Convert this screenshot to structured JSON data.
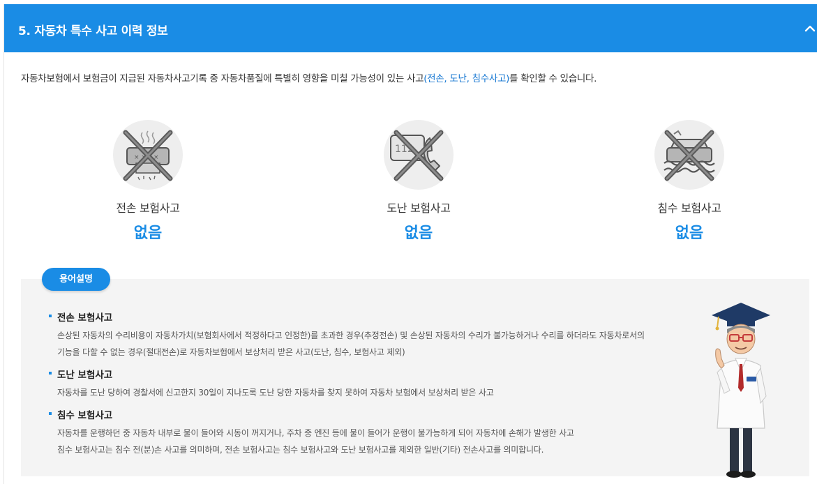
{
  "header": {
    "title": "5. 자동차 특수 사고 이력 정보",
    "toggle_icon": "chevron-up-icon"
  },
  "intro": {
    "text_before": "자동차보험에서 보험금이 지급된 자동차사고기록 중 자동차품질에 특별히 영향을 미칠 가능성이 있는 사고",
    "highlight": "(전손, 도난, 침수사고)",
    "text_after": "를 확인할 수 있습니다."
  },
  "accidents": [
    {
      "label": "전손 보험사고",
      "value": "없음",
      "icon": "wrecked-car-icon"
    },
    {
      "label": "도난 보험사고",
      "value": "없음",
      "icon": "stolen-car-phone-icon"
    },
    {
      "label": "침수 보험사고",
      "value": "없음",
      "icon": "flooded-car-icon"
    }
  ],
  "glossary": {
    "badge": "용어설명",
    "terms": [
      {
        "title": "전손 보험사고",
        "lines": [
          "손상된 자동차의 수리비용이 자동차가치(보험회사에서 적정하다고 인정한)를 초과한 경우(추정전손) 및 손상된 자동차의 수리가 불가능하거나 수리를 하더라도 자동차로서의",
          "기능을 다할 수 없는 경우(절대전손)로 자동차보험에서 보상처리 받은 사고(도난, 침수, 보험사고 제외)"
        ]
      },
      {
        "title": "도난 보험사고",
        "lines": [
          "자동차를 도난 당하여 경찰서에 신고한지 30일이 지나도록 도난 당한 자동차를 찾지 못하여 자동차 보험에서 보상처리 받은 사고"
        ]
      },
      {
        "title": "침수 보험사고",
        "lines": [
          "자동차를 운행하던 중 자동차 내부로 물이 들어와 시동이 꺼지거나, 주차 중 엔진 등에 물이 들어가 운행이 불가능하게 되어 자동차에 손해가 발생한 사고",
          "침수 보험사고는 침수 전(분)손 사고를 의미하며, 전손 보험사고는 침수 보험사고와 도난 보험사고를 제외한 일반(기타) 전손사고를 의미합니다."
        ]
      }
    ]
  },
  "colors": {
    "accent": "#1a8ce5",
    "highlight": "#1677d2",
    "glossary_bg": "#f4f4f4"
  }
}
